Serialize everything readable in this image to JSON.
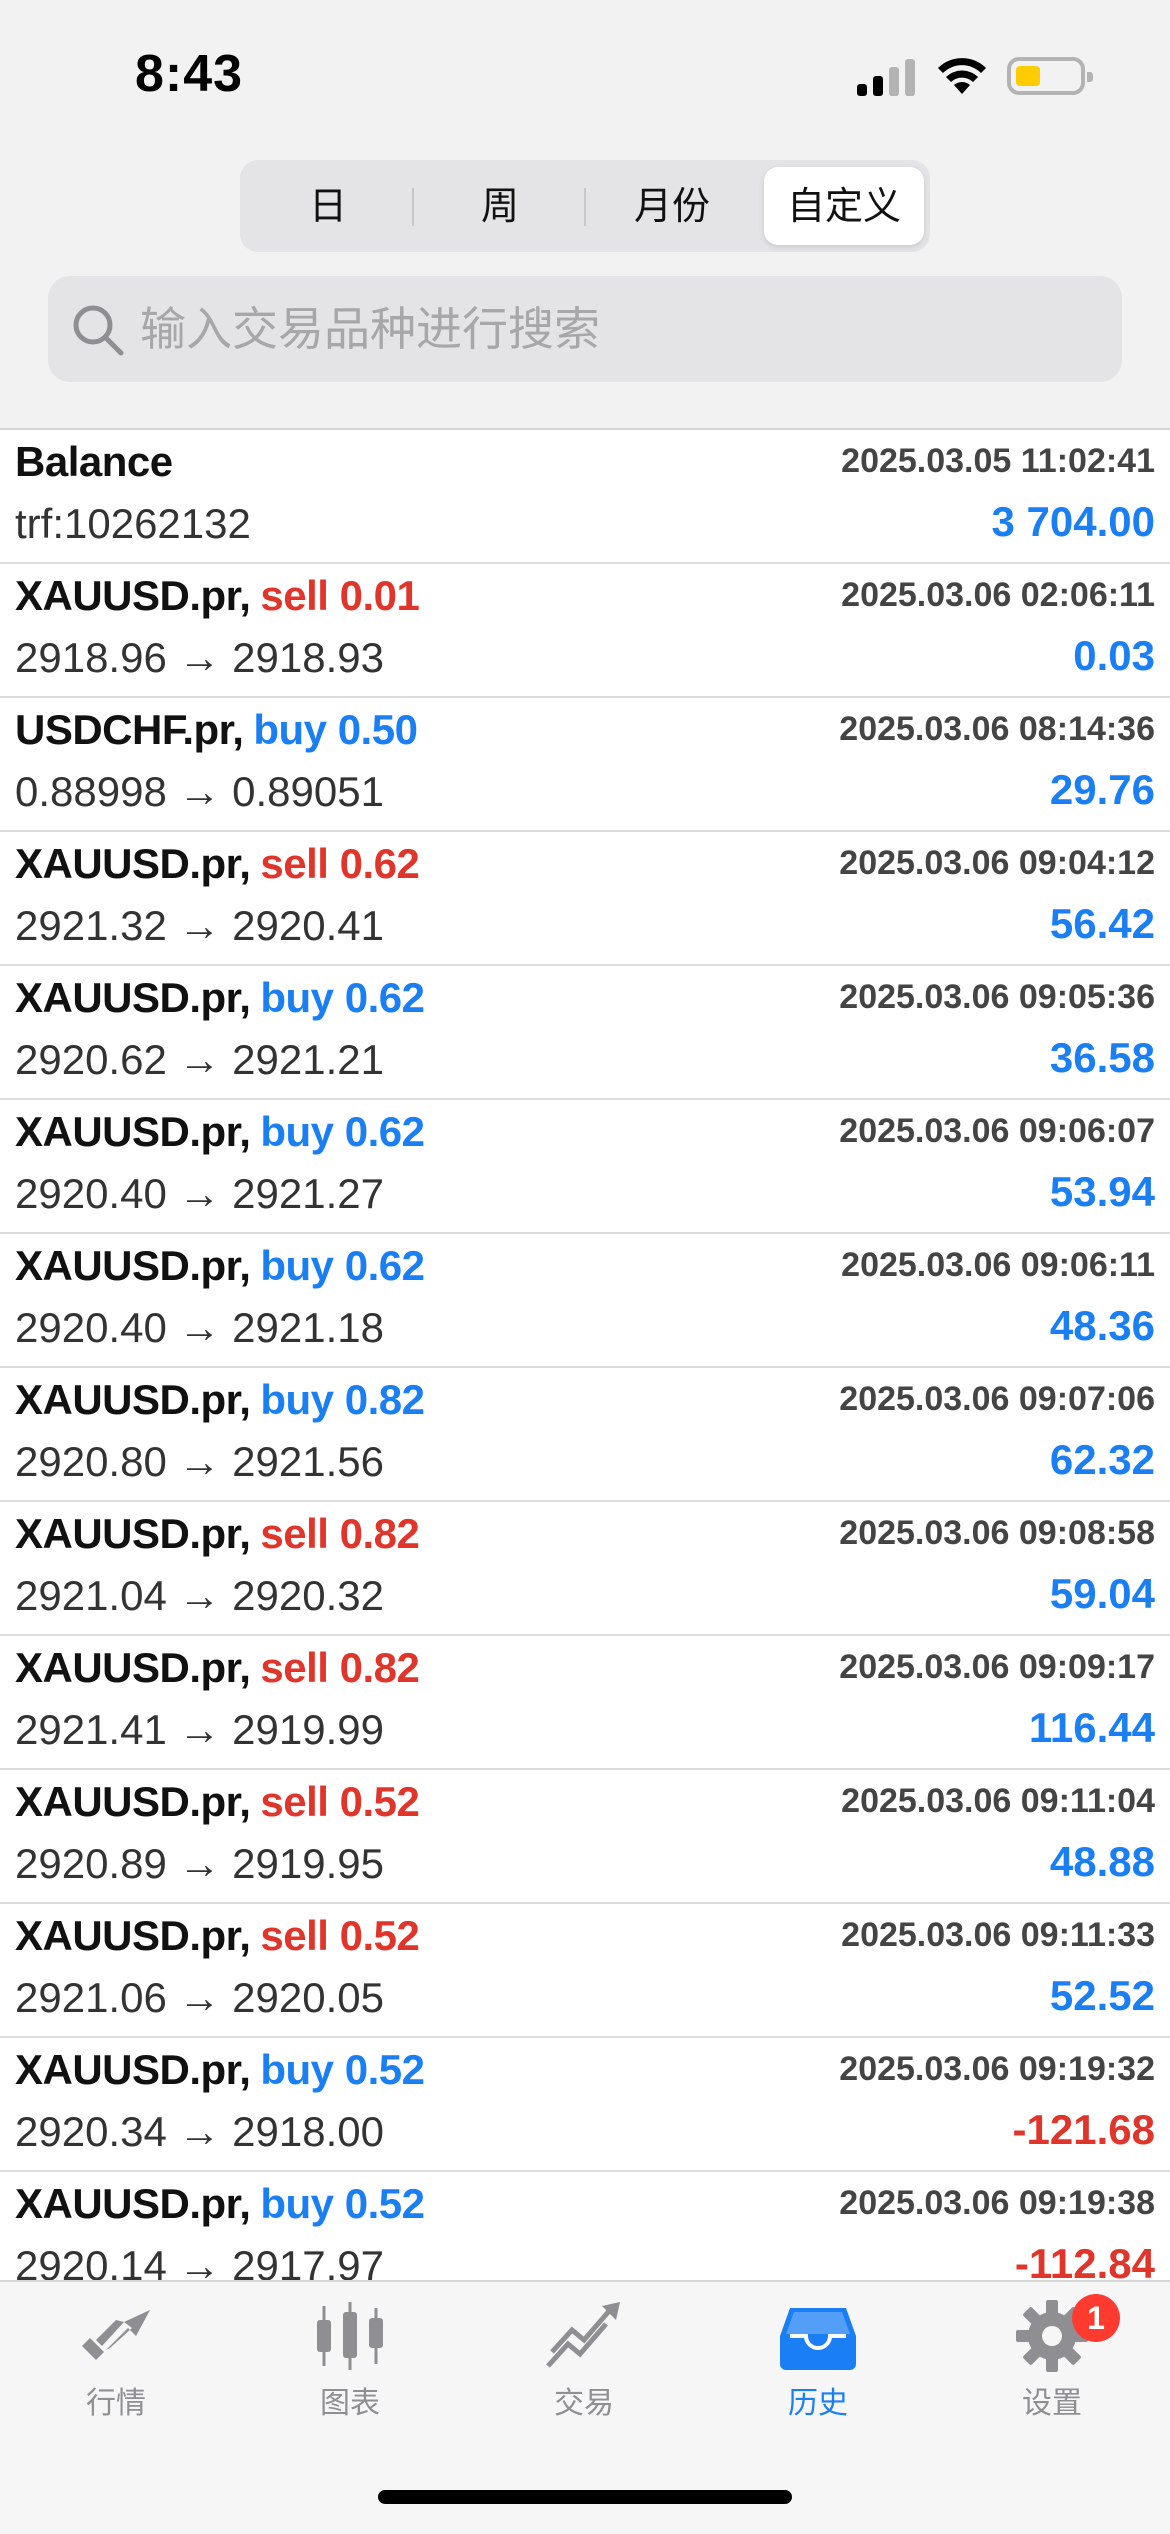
{
  "status": {
    "time": "8:43"
  },
  "segments": [
    "日",
    "周",
    "月份",
    "自定义"
  ],
  "active_segment": "自定义",
  "search": {
    "placeholder": "输入交易品种进行搜索"
  },
  "balance_row": {
    "label": "Balance",
    "sub": "trf:10262132",
    "timestamp": "2025.03.05 11:02:41",
    "amount": "3 704.00"
  },
  "trades": [
    {
      "symbol": "XAUUSD.pr,",
      "action": "sell 0.01",
      "side": "sell",
      "prices": "2918.96 → 2918.93",
      "timestamp": "2025.03.06 02:06:11",
      "profit": "0.03"
    },
    {
      "symbol": "USDCHF.pr,",
      "action": "buy 0.50",
      "side": "buy",
      "prices": "0.88998 → 0.89051",
      "timestamp": "2025.03.06 08:14:36",
      "profit": "29.76"
    },
    {
      "symbol": "XAUUSD.pr,",
      "action": "sell 0.62",
      "side": "sell",
      "prices": "2921.32 → 2920.41",
      "timestamp": "2025.03.06 09:04:12",
      "profit": "56.42"
    },
    {
      "symbol": "XAUUSD.pr,",
      "action": "buy 0.62",
      "side": "buy",
      "prices": "2920.62 → 2921.21",
      "timestamp": "2025.03.06 09:05:36",
      "profit": "36.58"
    },
    {
      "symbol": "XAUUSD.pr,",
      "action": "buy 0.62",
      "side": "buy",
      "prices": "2920.40 → 2921.27",
      "timestamp": "2025.03.06 09:06:07",
      "profit": "53.94"
    },
    {
      "symbol": "XAUUSD.pr,",
      "action": "buy 0.62",
      "side": "buy",
      "prices": "2920.40 → 2921.18",
      "timestamp": "2025.03.06 09:06:11",
      "profit": "48.36"
    },
    {
      "symbol": "XAUUSD.pr,",
      "action": "buy 0.82",
      "side": "buy",
      "prices": "2920.80 → 2921.56",
      "timestamp": "2025.03.06 09:07:06",
      "profit": "62.32"
    },
    {
      "symbol": "XAUUSD.pr,",
      "action": "sell 0.82",
      "side": "sell",
      "prices": "2921.04 → 2920.32",
      "timestamp": "2025.03.06 09:08:58",
      "profit": "59.04"
    },
    {
      "symbol": "XAUUSD.pr,",
      "action": "sell 0.82",
      "side": "sell",
      "prices": "2921.41 → 2919.99",
      "timestamp": "2025.03.06 09:09:17",
      "profit": "116.44"
    },
    {
      "symbol": "XAUUSD.pr,",
      "action": "sell 0.52",
      "side": "sell",
      "prices": "2920.89 → 2919.95",
      "timestamp": "2025.03.06 09:11:04",
      "profit": "48.88"
    },
    {
      "symbol": "XAUUSD.pr,",
      "action": "sell 0.52",
      "side": "sell",
      "prices": "2921.06 → 2920.05",
      "timestamp": "2025.03.06 09:11:33",
      "profit": "52.52"
    },
    {
      "symbol": "XAUUSD.pr,",
      "action": "buy 0.52",
      "side": "buy",
      "prices": "2920.34 → 2918.00",
      "timestamp": "2025.03.06 09:19:32",
      "profit": "-121.68"
    },
    {
      "symbol": "XAUUSD.pr,",
      "action": "buy 0.52",
      "side": "buy",
      "prices": "2920.14 → 2917.97",
      "timestamp": "2025.03.06 09:19:38",
      "profit": "-112.84"
    }
  ],
  "tabbar": {
    "items": [
      {
        "label": "行情",
        "icon": "quotes-icon"
      },
      {
        "label": "图表",
        "icon": "chart-icon"
      },
      {
        "label": "交易",
        "icon": "trade-icon"
      },
      {
        "label": "历史",
        "icon": "history-icon"
      },
      {
        "label": "设置",
        "icon": "settings-icon"
      }
    ],
    "active": "历史",
    "settings_badge": "1"
  },
  "colors": {
    "accent": "#1a7ff5",
    "sell": "#e0352b",
    "inactive": "#8e8e93"
  }
}
